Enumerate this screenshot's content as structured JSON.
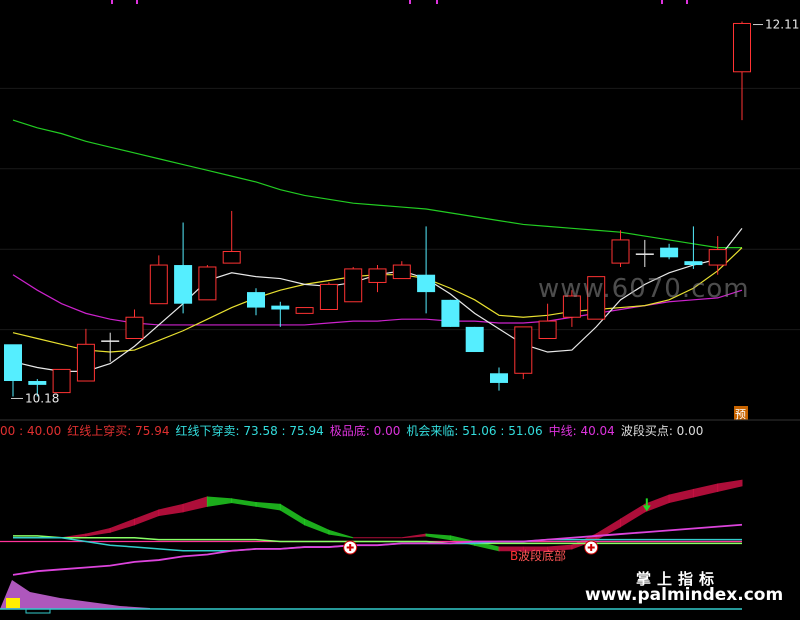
{
  "chart_data": {
    "type": "candlestick",
    "main": {
      "candles": [
        {
          "o": 10.25,
          "h": 10.38,
          "l": 10.17,
          "c": 10.44,
          "dir": "down"
        },
        {
          "o": 10.25,
          "h": 10.26,
          "l": 10.17,
          "c": 10.23,
          "dir": "down"
        },
        {
          "o": 10.19,
          "h": 10.31,
          "l": 10.19,
          "c": 10.31,
          "dir": "up"
        },
        {
          "o": 10.25,
          "h": 10.52,
          "l": 10.25,
          "c": 10.44,
          "dir": "up"
        },
        {
          "o": 10.46,
          "h": 10.5,
          "l": 10.35,
          "c": 10.46,
          "dir": "flat"
        },
        {
          "o": 10.47,
          "h": 10.62,
          "l": 10.47,
          "c": 10.58,
          "dir": "up"
        },
        {
          "o": 10.65,
          "h": 10.9,
          "l": 10.65,
          "c": 10.85,
          "dir": "up"
        },
        {
          "o": 10.85,
          "h": 11.07,
          "l": 10.6,
          "c": 10.65,
          "dir": "down"
        },
        {
          "o": 10.67,
          "h": 10.85,
          "l": 10.67,
          "c": 10.84,
          "dir": "up"
        },
        {
          "o": 10.86,
          "h": 11.13,
          "l": 10.86,
          "c": 10.92,
          "dir": "up"
        },
        {
          "o": 10.71,
          "h": 10.73,
          "l": 10.59,
          "c": 10.63,
          "dir": "down"
        },
        {
          "o": 10.64,
          "h": 10.66,
          "l": 10.53,
          "c": 10.62,
          "dir": "down"
        },
        {
          "o": 10.6,
          "h": 10.63,
          "l": 10.6,
          "c": 10.63,
          "dir": "up"
        },
        {
          "o": 10.62,
          "h": 10.76,
          "l": 10.62,
          "c": 10.75,
          "dir": "up"
        },
        {
          "o": 10.66,
          "h": 10.84,
          "l": 10.66,
          "c": 10.83,
          "dir": "up"
        },
        {
          "o": 10.76,
          "h": 10.85,
          "l": 10.71,
          "c": 10.83,
          "dir": "up"
        },
        {
          "o": 10.78,
          "h": 10.87,
          "l": 10.78,
          "c": 10.85,
          "dir": "up"
        },
        {
          "o": 10.8,
          "h": 11.05,
          "l": 10.6,
          "c": 10.71,
          "dir": "down"
        },
        {
          "o": 10.67,
          "h": 10.67,
          "l": 10.53,
          "c": 10.53,
          "dir": "down"
        },
        {
          "o": 10.53,
          "h": 10.53,
          "l": 10.4,
          "c": 10.4,
          "dir": "down"
        },
        {
          "o": 10.29,
          "h": 10.32,
          "l": 10.2,
          "c": 10.24,
          "dir": "down"
        },
        {
          "o": 10.29,
          "h": 10.53,
          "l": 10.26,
          "c": 10.53,
          "dir": "up"
        },
        {
          "o": 10.47,
          "h": 10.65,
          "l": 10.47,
          "c": 10.56,
          "dir": "up"
        },
        {
          "o": 10.58,
          "h": 10.72,
          "l": 10.53,
          "c": 10.69,
          "dir": "up"
        },
        {
          "o": 10.57,
          "h": 10.79,
          "l": 10.57,
          "c": 10.79,
          "dir": "up"
        },
        {
          "o": 10.86,
          "h": 11.03,
          "l": 10.84,
          "c": 10.98,
          "dir": "up"
        },
        {
          "o": 10.91,
          "h": 10.98,
          "l": 10.84,
          "c": 10.91,
          "dir": "flat"
        },
        {
          "o": 10.94,
          "h": 10.96,
          "l": 10.88,
          "c": 10.89,
          "dir": "down"
        },
        {
          "o": 10.87,
          "h": 11.05,
          "l": 10.83,
          "c": 10.85,
          "dir": "down"
        },
        {
          "o": 10.85,
          "h": 11.0,
          "l": 10.8,
          "c": 10.93,
          "dir": "up"
        },
        {
          "o": 11.85,
          "h": 12.11,
          "l": 11.6,
          "c": 12.1,
          "dir": "up"
        }
      ],
      "ma_white": [
        10.35,
        10.32,
        10.3,
        10.3,
        10.34,
        10.43,
        10.54,
        10.65,
        10.77,
        10.81,
        10.79,
        10.78,
        10.75,
        10.74,
        10.76,
        10.8,
        10.82,
        10.78,
        10.7,
        10.6,
        10.52,
        10.44,
        10.4,
        10.41,
        10.53,
        10.67,
        10.75,
        10.81,
        10.85,
        10.88,
        11.04
      ],
      "ma_yellow": [
        10.5,
        10.47,
        10.44,
        10.41,
        10.4,
        10.41,
        10.46,
        10.51,
        10.57,
        10.63,
        10.68,
        10.72,
        10.75,
        10.77,
        10.79,
        10.8,
        10.8,
        10.78,
        10.73,
        10.67,
        10.59,
        10.58,
        10.59,
        10.61,
        10.62,
        10.63,
        10.64,
        10.67,
        10.73,
        10.82,
        10.94
      ],
      "ma_magenta": [
        10.8,
        10.72,
        10.65,
        10.6,
        10.57,
        10.55,
        10.54,
        10.54,
        10.54,
        10.54,
        10.54,
        10.54,
        10.54,
        10.55,
        10.56,
        10.56,
        10.57,
        10.57,
        10.56,
        10.56,
        10.55,
        10.55,
        10.56,
        10.58,
        10.6,
        10.62,
        10.64,
        10.66,
        10.67,
        10.68,
        10.72
      ],
      "ma_green": [
        11.6,
        11.56,
        11.53,
        11.49,
        11.46,
        11.43,
        11.4,
        11.37,
        11.34,
        11.31,
        11.28,
        11.24,
        11.21,
        11.19,
        11.17,
        11.16,
        11.15,
        11.14,
        11.12,
        11.1,
        11.08,
        11.06,
        11.05,
        11.04,
        11.03,
        11.02,
        11.0,
        10.98,
        10.96,
        10.94,
        10.94
      ],
      "y_range": [
        10.1,
        12.18
      ],
      "high_label": "12.11",
      "low_label": "10.18",
      "badge": "预"
    },
    "indicator": {
      "legend": [
        {
          "text": "00 : 40.00",
          "color": "#e03030"
        },
        {
          "text": "红线上穿买: 75.94",
          "color": "#e03030"
        },
        {
          "text": "红线下穿卖: 73.58 : 75.94",
          "color": "#33dddd"
        },
        {
          "text": "极品底: 0.00",
          "color": "#dd33dd"
        },
        {
          "text": "机会来临: 51.06 : 51.06",
          "color": "#33dddd"
        },
        {
          "text": "中线: 40.04",
          "color": "#dd33dd"
        },
        {
          "text": "波段买点: 0.00",
          "color": "#dddddd"
        }
      ],
      "upper_band": [
        40,
        40,
        40,
        42,
        45,
        50,
        55,
        58,
        62,
        61,
        59,
        58,
        50,
        44,
        40,
        40,
        40,
        42,
        41,
        38,
        35,
        35,
        35,
        36,
        42,
        50,
        58,
        63,
        66,
        69,
        71
      ],
      "lower_band": [
        40,
        40,
        40,
        41,
        43,
        47,
        52,
        54,
        57,
        59,
        57,
        55,
        47,
        42,
        40,
        40,
        40,
        41,
        39,
        36,
        33,
        33,
        33,
        34,
        39,
        46,
        54,
        59,
        62,
        65,
        68
      ],
      "green_line": [
        41,
        41,
        40,
        40,
        40,
        40,
        39,
        39,
        39,
        39,
        39,
        38,
        38,
        38,
        38,
        38,
        38,
        38,
        37,
        37,
        37,
        37,
        37,
        37,
        37,
        37,
        37,
        37,
        37,
        37,
        37
      ],
      "magenta_line": [
        20,
        22,
        23,
        24,
        25,
        27,
        28,
        30,
        31,
        33,
        34,
        34,
        35,
        35,
        36,
        36,
        37,
        37,
        37,
        38,
        38,
        38,
        39,
        40,
        41,
        42,
        43,
        44,
        45,
        46,
        47
      ],
      "cyan_line": [
        40,
        40,
        40,
        38,
        36,
        35,
        34,
        33,
        33,
        33,
        34,
        34,
        35,
        35,
        36,
        36,
        37,
        37,
        37,
        37,
        38,
        38,
        39,
        39,
        39,
        39,
        39,
        39,
        39,
        39,
        39
      ],
      "pink_baseline": 38,
      "y_range": [
        0,
        90
      ],
      "cross_markers": [
        14,
        24
      ],
      "green_arrow": 26,
      "label": "波段底部",
      "label_badge": "B"
    },
    "watermarks": {
      "site_6070": "www.6070.com",
      "cn": "掌上指标",
      "url": "www.palmindex.com"
    }
  }
}
